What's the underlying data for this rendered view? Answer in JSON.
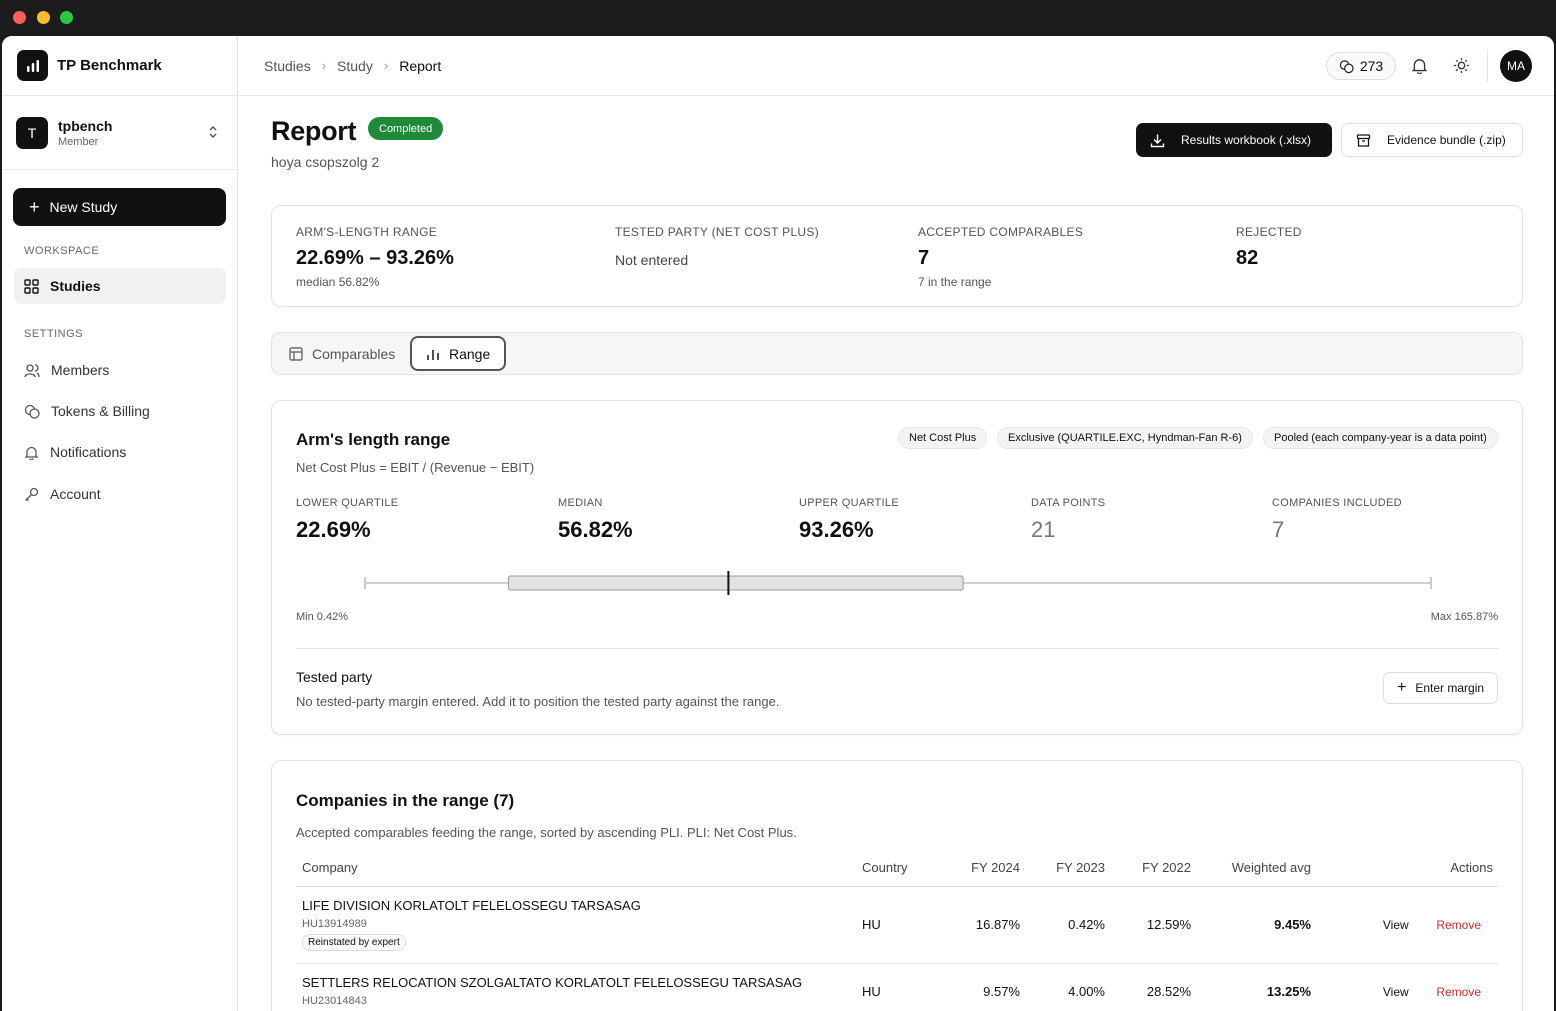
{
  "window": {
    "dot_colors": [
      "#ff5f57",
      "#febc2e",
      "#28c840"
    ]
  },
  "brand": {
    "name": "TP Benchmark",
    "icon": "bar-chart-icon"
  },
  "org": {
    "initial": "T",
    "name": "tpbench",
    "role": "Member"
  },
  "sidebar": {
    "new_study": "New Study",
    "workspace_label": "WORKSPACE",
    "studies": "Studies",
    "settings_label": "SETTINGS",
    "items": [
      "Members",
      "Tokens & Billing",
      "Notifications",
      "Account"
    ]
  },
  "topbar": {
    "breadcrumb": [
      "Studies",
      "Study",
      "Report"
    ],
    "tokens": "273",
    "avatar": "MA"
  },
  "header": {
    "title": "Report",
    "status": "Completed",
    "subtitle": "hoya csopszolg 2",
    "btn_results": "Results workbook (.xlsx)",
    "btn_evidence": "Evidence bundle (.zip)"
  },
  "summary": {
    "range_label": "ARM'S-LENGTH RANGE",
    "range_value": "22.69% – 93.26%",
    "range_sub": "median 56.82%",
    "tested_label": "TESTED PARTY (NET COST PLUS)",
    "tested_value": "Not entered",
    "accepted_label": "ACCEPTED COMPARABLES",
    "accepted_value": "7",
    "accepted_sub": "7 in the range",
    "rejected_label": "REJECTED",
    "rejected_value": "82"
  },
  "tabs": [
    "Comparables",
    "Range"
  ],
  "range_card": {
    "title": "Arm's length range",
    "formula": "Net Cost Plus = EBIT / (Revenue − EBIT)",
    "chips": [
      "Net Cost Plus",
      "Exclusive (QUARTILE.EXC, Hyndman-Fan R-6)",
      "Pooled (each company-year is a data point)"
    ],
    "lq_label": "LOWER QUARTILE",
    "lq_value": "22.69%",
    "med_label": "MEDIAN",
    "med_value": "56.82%",
    "uq_label": "UPPER QUARTILE",
    "uq_value": "93.26%",
    "dp_label": "DATA POINTS",
    "dp_value": "21",
    "ci_label": "COMPANIES INCLUDED",
    "ci_value": "7",
    "min_label": "Min 0.42%",
    "max_label": "Max 165.87%",
    "stats": {
      "min": 0.42,
      "lq": 22.69,
      "median": 56.82,
      "uq": 93.26,
      "max": 165.87
    },
    "tested_title": "Tested party",
    "tested_desc": "No tested-party margin entered. Add it to position the tested party against the range.",
    "enter_margin": "Enter margin"
  },
  "companies": {
    "title": "Companies in the range (7)",
    "desc": "Accepted comparables feeding the range, sorted by ascending PLI. PLI: Net Cost Plus.",
    "columns": [
      "Company",
      "Country",
      "FY 2024",
      "FY 2023",
      "FY 2022",
      "Weighted avg",
      "Actions"
    ],
    "view": "View",
    "remove": "Remove",
    "rows": [
      {
        "name": "LIFE DIVISION KORLATOLT FELELOSSEGU TARSASAG",
        "id": "HU13914989",
        "tag": "Reinstated by expert",
        "country": "HU",
        "fy2024": "16.87%",
        "fy2023": "0.42%",
        "fy2022": "12.59%",
        "wavg": "9.45%"
      },
      {
        "name": "SETTLERS RELOCATION SZOLGALTATO KORLATOLT FELELOSSEGU TARSASAG",
        "id": "HU23014843",
        "tag": "",
        "country": "HU",
        "fy2024": "9.57%",
        "fy2023": "4.00%",
        "fy2022": "28.52%",
        "wavg": "13.25%"
      }
    ]
  }
}
